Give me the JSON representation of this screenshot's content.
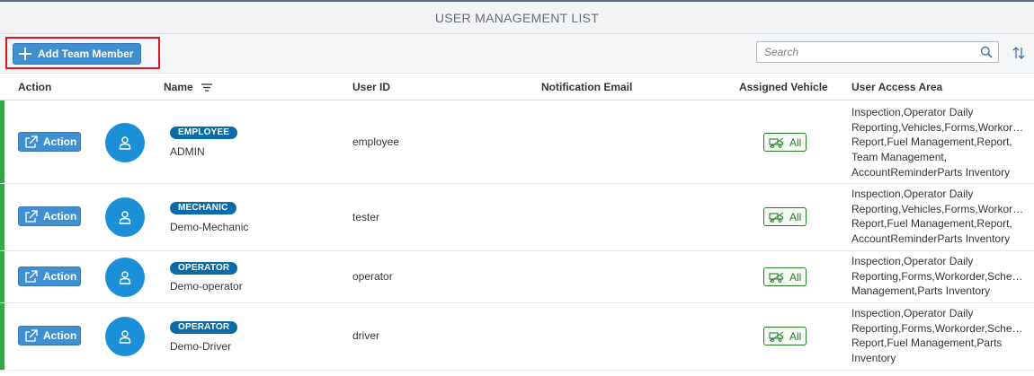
{
  "page": {
    "title": "USER MANAGEMENT LIST"
  },
  "toolbar": {
    "add_label": "Add Team Member",
    "search_placeholder": "Search"
  },
  "columns": {
    "action": "Action",
    "name": "Name",
    "user_id": "User ID",
    "notification_email": "Notification Email",
    "assigned_vehicle": "Assigned Vehicle",
    "user_access_area": "User Access Area"
  },
  "icons": {
    "add": "plus-icon",
    "search": "search-icon",
    "sort": "sort-icon",
    "name_filter": "filter-lines-icon",
    "action": "external-link-icon",
    "avatar": "person-icon",
    "vehicle": "truck-icon"
  },
  "colors": {
    "button_blue": "#3f8fd1",
    "badge_blue": "#0a6ba8",
    "avatar_blue": "#1b90d9",
    "status_green": "#34a548",
    "vehicle_green": "#2b7d2b",
    "highlight_red": "#e0161b"
  },
  "rows": [
    {
      "action": "Action",
      "role": "EMPLOYEE",
      "name": "ADMIN",
      "user_id": "employee",
      "email": "",
      "vehicle": "All",
      "access_lines": [
        "Inspection,Operator Daily",
        "Reporting,Vehicles,Forms,Workorder",
        "Report,Fuel Management,Report,",
        "Team Management,",
        "AccountReminderParts Inventory"
      ]
    },
    {
      "action": "Action",
      "role": "MECHANIC",
      "name": "Demo-Mechanic",
      "user_id": "tester",
      "email": "",
      "vehicle": "All",
      "access_lines": [
        "Inspection,Operator Daily",
        "Reporting,Vehicles,Forms,Workorder",
        "Report,Fuel Management,Report,",
        "AccountReminderParts Inventory"
      ]
    },
    {
      "action": "Action",
      "role": "OPERATOR",
      "name": "Demo-operator",
      "user_id": "operator",
      "email": "",
      "vehicle": "All",
      "access_lines": [
        "Inspection,Operator Daily",
        "Reporting,Forms,Workorder,Schedule",
        "Management,Parts Inventory"
      ]
    },
    {
      "action": "Action",
      "role": "OPERATOR",
      "name": "Demo-Driver",
      "user_id": "driver",
      "email": "",
      "vehicle": "All",
      "access_lines": [
        "Inspection,Operator Daily",
        "Reporting,Forms,Workorder,Schedule",
        "Report,Fuel Management,Parts",
        "Inventory"
      ]
    }
  ]
}
